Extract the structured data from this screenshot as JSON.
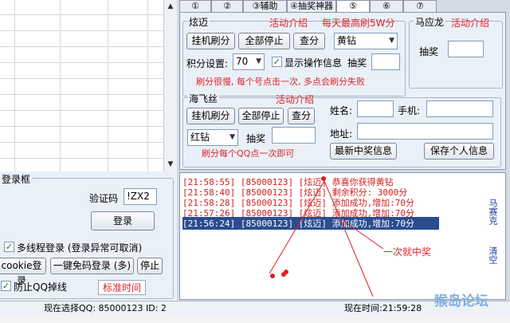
{
  "tabs": [
    "①",
    "②",
    "③辅助",
    "④抽奖神器",
    "⑤",
    "⑥",
    "⑦"
  ],
  "xuanmai": {
    "title": "炫迈",
    "promo": "活动介绍",
    "promo2": "每天最高刷5W分",
    "btn_hangup": "挂机刷分",
    "btn_stop_all": "全部停止",
    "btn_query": "查分",
    "diamond_select": "黄钻",
    "score_label": "积分设置:",
    "score_value": "70",
    "show_ops_label": "显示操作信息",
    "draw_label": "抽奖",
    "draw_value": "",
    "warning": "刷分很慢, 每个号点击一次, 多点会刷分失败"
  },
  "mayinglong": {
    "title": "马应龙",
    "promo": "活动介绍",
    "draw_label": "抽奖",
    "draw_value": ""
  },
  "haifeisi": {
    "title": "海飞丝",
    "promo": "活动介绍",
    "btn_hangup": "挂机刷分",
    "btn_stop_all": "全部停止",
    "btn_query": "查分",
    "diamond_select": "红钻",
    "draw_label": "抽奖",
    "draw_value": "",
    "note": "刷分每个QQ点一次即可",
    "name_label": "姓名:",
    "name_value": "",
    "phone_label": "手机:",
    "phone_value": "",
    "addr_label": "地址:",
    "addr_value": "",
    "btn_latest": "最新中奖信息",
    "btn_save": "保存个人信息"
  },
  "log": {
    "lines": [
      "[21:58:55] [85000123] [炫迈] 恭喜你获得黄钻",
      "[21:58:40] [85000123] [炫迈] 剩余积分: 3000分",
      "[21:58:28] [85000123] [炫迈] 添加成功,增加:70分",
      "[21:57:26] [85000123] [炫迈] 添加成功,增加:70分",
      "[21:56:24] [85000123] [炫迈] 添加成功,增加:70分"
    ],
    "right_label": "马赛克",
    "clear_label": "清空",
    "annotation": "一次就中奖"
  },
  "login": {
    "title": "登录框",
    "captcha_label": "验证码",
    "captcha_value": "!ZX2",
    "btn_login": "登录",
    "multithread_label": "多线程登录 (登录异常可取消)",
    "btn_cookie": "cookie登录",
    "btn_onekey": "一键免码登录 (多)",
    "btn_stop": "停止",
    "anti_drop_label": "防止QQ掉线",
    "std_time_label": "标准时间"
  },
  "status": {
    "current_qq": "现在选择QQ: 85000123  ID: 2",
    "current_time": "现在时间:21:59:28"
  },
  "watermark": "猴岛论坛"
}
